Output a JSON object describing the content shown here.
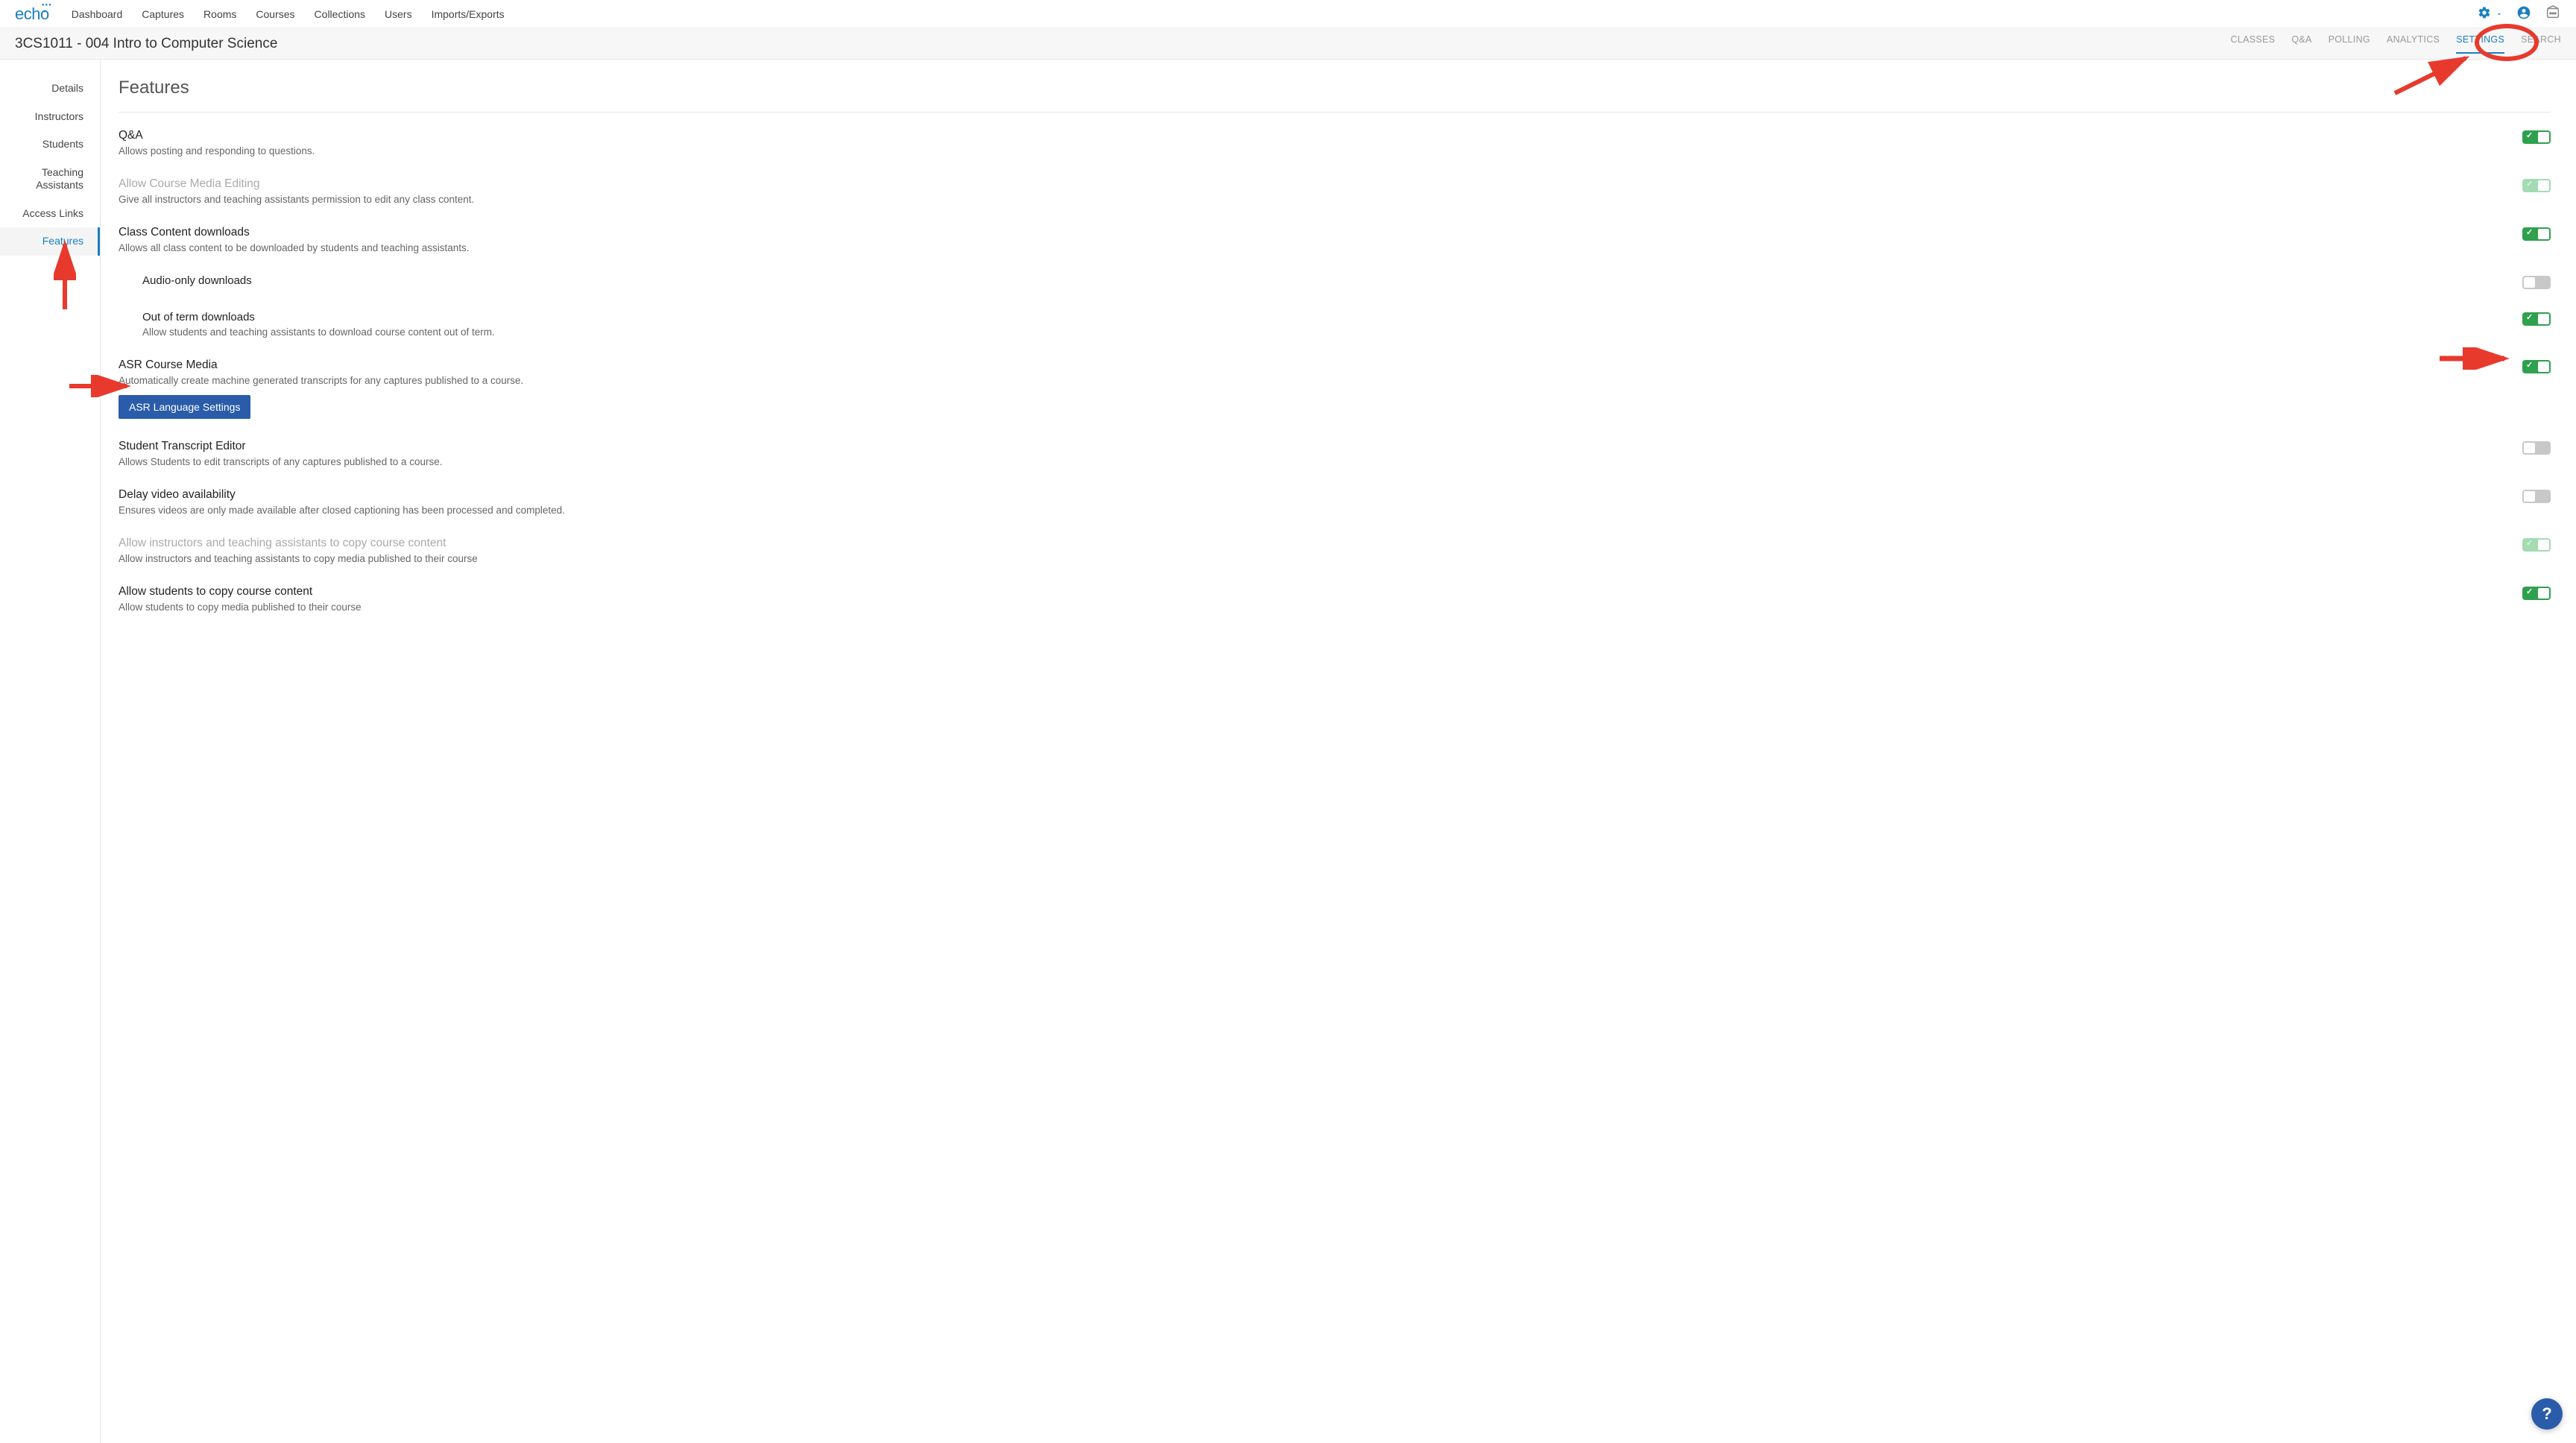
{
  "brand": "echo",
  "topnav": [
    "Dashboard",
    "Captures",
    "Rooms",
    "Courses",
    "Collections",
    "Users",
    "Imports/Exports"
  ],
  "course_title": "3CS1011 - 004 Intro to Computer Science",
  "subtabs": [
    {
      "label": "CLASSES",
      "active": false
    },
    {
      "label": "Q&A",
      "active": false
    },
    {
      "label": "POLLING",
      "active": false
    },
    {
      "label": "ANALYTICS",
      "active": false
    },
    {
      "label": "SETTINGS",
      "active": true
    },
    {
      "label": "SEARCH",
      "active": false
    }
  ],
  "sidebar": [
    {
      "label": "Details",
      "active": false
    },
    {
      "label": "Instructors",
      "active": false
    },
    {
      "label": "Students",
      "active": false
    },
    {
      "label": "Teaching Assistants",
      "active": false
    },
    {
      "label": "Access Links",
      "active": false
    },
    {
      "label": "Features",
      "active": true
    }
  ],
  "page_heading": "Features",
  "asr_button": "ASR Language Settings",
  "features": {
    "qa": {
      "title": "Q&A",
      "desc": "Allows posting and responding to questions."
    },
    "edit": {
      "title": "Allow Course Media Editing",
      "desc": "Give all instructors and teaching assistants permission to edit any class content."
    },
    "downloads": {
      "title": "Class Content downloads",
      "desc": "Allows all class content to be downloaded by students and teaching assistants."
    },
    "audio_only": {
      "title": "Audio-only downloads"
    },
    "out_of_term": {
      "title": "Out of term downloads",
      "desc": "Allow students and teaching assistants to download course content out of term."
    },
    "asr": {
      "title": "ASR Course Media",
      "desc": "Automatically create machine generated transcripts for any captures published to a course."
    },
    "student_transcript": {
      "title": "Student Transcript Editor",
      "desc": "Allows Students to edit transcripts of any captures published to a course."
    },
    "delay": {
      "title": "Delay video availability",
      "desc": "Ensures videos are only made available after closed captioning has been processed and completed."
    },
    "copy_instr": {
      "title": "Allow instructors and teaching assistants to copy course content",
      "desc": "Allow instructors and teaching assistants to copy media published to their course"
    },
    "copy_students": {
      "title": "Allow students to copy course content",
      "desc": "Allow students to copy media published to their course"
    }
  },
  "help_label": "?"
}
